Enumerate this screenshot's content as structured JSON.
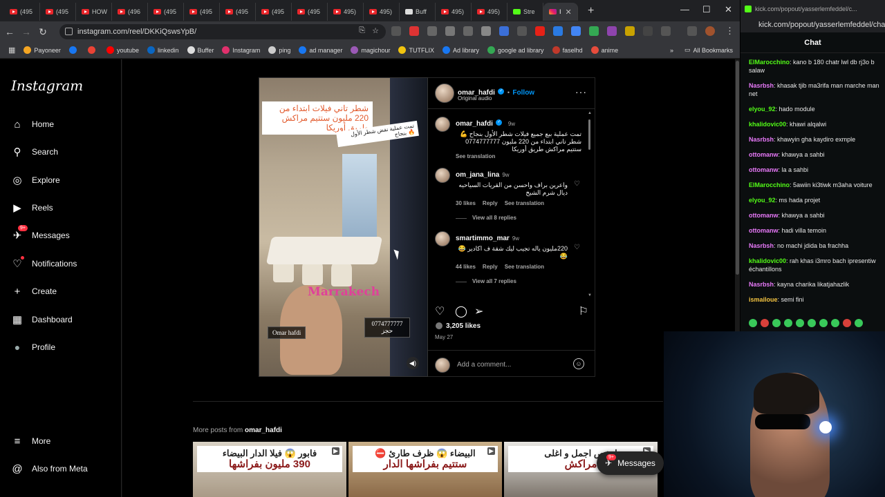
{
  "browser": {
    "tabs": [
      {
        "label": "(495",
        "icon": "youtube-icon"
      },
      {
        "label": "(495",
        "icon": "youtube-icon"
      },
      {
        "label": "HOW",
        "icon": "youtube-icon"
      },
      {
        "label": "(496",
        "icon": "youtube-icon"
      },
      {
        "label": "(495",
        "icon": "youtube-icon"
      },
      {
        "label": "(495",
        "icon": "youtube-icon"
      },
      {
        "label": "(495",
        "icon": "youtube-icon"
      },
      {
        "label": "(495",
        "icon": "youtube-icon"
      },
      {
        "label": "(495",
        "icon": "youtube-icon"
      },
      {
        "label": "495)",
        "icon": "youtube-icon"
      },
      {
        "label": "495)",
        "icon": "youtube-icon"
      },
      {
        "label": "Buff",
        "icon": "buffer-icon"
      },
      {
        "label": "495)",
        "icon": "youtube-icon"
      },
      {
        "label": "495)",
        "icon": "youtube-icon"
      },
      {
        "label": "Stre",
        "icon": "kick-icon"
      },
      {
        "label": "I",
        "icon": "instagram-icon"
      }
    ],
    "url": "instagram.com/reel/DKKiQswsYpB/",
    "bookmarks": [
      {
        "label": "Payoneer",
        "color": "#f5a623"
      },
      {
        "label": "",
        "color": "#1877f2"
      },
      {
        "label": "",
        "color": "#ea4335"
      },
      {
        "label": "youtube",
        "color": "#ff0000"
      },
      {
        "label": "linkedin",
        "color": "#0a66c2"
      },
      {
        "label": "Buffer",
        "color": "#dddddd"
      },
      {
        "label": "Instagram",
        "color": "#e1306c"
      },
      {
        "label": "ping",
        "color": "#cccccc"
      },
      {
        "label": "ad manager",
        "color": "#1877f2"
      },
      {
        "label": "magichour",
        "color": "#9b59b6"
      },
      {
        "label": "TUTFLIX",
        "color": "#f1c40f"
      },
      {
        "label": "Ad library",
        "color": "#1877f2"
      },
      {
        "label": "google ad library",
        "color": "#34a853"
      },
      {
        "label": "faselhd",
        "color": "#c0392b"
      },
      {
        "label": "anime",
        "color": "#e74c3c"
      }
    ],
    "all_bookmarks": "All Bookmarks"
  },
  "instagram": {
    "logo": "Instagram",
    "nav": [
      {
        "label": "Home",
        "icon": "home-icon",
        "glyph": "⌂"
      },
      {
        "label": "Search",
        "icon": "search-icon",
        "glyph": "⚲"
      },
      {
        "label": "Explore",
        "icon": "compass-icon",
        "glyph": "◎"
      },
      {
        "label": "Reels",
        "icon": "reels-icon",
        "glyph": "▶"
      },
      {
        "label": "Messages",
        "icon": "messenger-icon",
        "glyph": "✈"
      },
      {
        "label": "Notifications",
        "icon": "heart-icon",
        "glyph": "♡"
      },
      {
        "label": "Create",
        "icon": "plus-icon",
        "glyph": "+"
      },
      {
        "label": "Dashboard",
        "icon": "dashboard-icon",
        "glyph": "▦"
      },
      {
        "label": "Profile",
        "icon": "avatar-icon",
        "glyph": "●"
      }
    ],
    "messages_badge": "9+",
    "more": "More",
    "also_from_meta": "Also from Meta",
    "reel": {
      "overlay_title": "شطر تاني فيلات ابتداء من 220 مليون ستتيم مراكش طريق أوريكا",
      "overlay_sub": "تمت عملية نفض شطر الأول بنجاح 🔥",
      "watermark": "Marrakech",
      "name_tag": "Omar hafdi",
      "phone_tag": "0774777777",
      "phone_sub": "حجز"
    },
    "post": {
      "username": "omar_hafdi",
      "follow": "Follow",
      "audio": "Original audio",
      "caption_user": "omar_hafdi",
      "caption_time": "9w",
      "caption": "تمت عملية بيع جميع فيلات شطر الأول بنجاح 💪 شطر تاني ابتداء من 220 مليون 0774777777 ستتيم مراكش طريق أوريكا",
      "see_translation": "See translation",
      "comments": [
        {
          "user": "om_jana_lina",
          "time": "9w",
          "text": "واعرين براف واحسن من القريات السياحيه ديال شرم الشيخ",
          "likes": "30 likes",
          "reply": "Reply",
          "translate": "See translation",
          "replies": "View all 8 replies"
        },
        {
          "user": "smartimmo_mar",
          "time": "9w",
          "text": "220مليون ياله تجيب ليك شقة ف اكادير 😂😂",
          "likes": "44 likes",
          "reply": "Reply",
          "translate": "See translation",
          "replies": "View all 7 replies"
        }
      ],
      "likes": "3,205 likes",
      "date": "May 27",
      "add_comment": "Add a comment..."
    },
    "more_posts_label": "More posts from",
    "more_posts_user": "omar_hafdi",
    "thumbs": [
      {
        "caption": "فابور 😱 فيلا الدار البيضاء",
        "price": "390 مليون بفراشها"
      },
      {
        "caption": "البيضاء 😱 ظرف طارئ ⛔",
        "price": "ستتيم بفراشها الدار"
      },
      {
        "caption": "ارخص اجمل و اغلى",
        "price": "مراكش"
      }
    ],
    "messages_pill": "Messages",
    "messages_pill_badge": "9+"
  },
  "kick": {
    "title": "kick.com/popout/yasserlemfeddel/c...",
    "url": "kick.com/popout/yasserlemfeddel/chat",
    "chat_header": "Chat",
    "messages": [
      {
        "user": "ElMarocchino",
        "color": "#53fc18",
        "text": "kano b 180 chatr lwl db rj3o b salaw"
      },
      {
        "user": "Nasrbsh",
        "color": "#e879f9",
        "text": "khasak tjib ma3rifa man marche man net"
      },
      {
        "user": "elyou_92",
        "color": "#53fc18",
        "text": "hado module"
      },
      {
        "user": "khalidovic00",
        "color": "#53fc18",
        "text": "khawi alqalwi"
      },
      {
        "user": "Nasrbsh",
        "color": "#e879f9",
        "text": "khawyin gha kaydiro exmple"
      },
      {
        "user": "ottomanw",
        "color": "#e879f9",
        "text": "khawya a sahbi"
      },
      {
        "user": "ottomanw",
        "color": "#e879f9",
        "text": "la a sahbi"
      },
      {
        "user": "ElMarocchino",
        "color": "#53fc18",
        "text": "5awiin ki3tiwk m3aha voiture"
      },
      {
        "user": "elyou_92",
        "color": "#53fc18",
        "text": "ms hada projet"
      },
      {
        "user": "ottomanw",
        "color": "#e879f9",
        "text": "khawya a sahbi"
      },
      {
        "user": "ottomanw",
        "color": "#e879f9",
        "text": "hadi villa temoin"
      },
      {
        "user": "Nasrbsh",
        "color": "#e879f9",
        "text": "no machi jdida ba frachha"
      },
      {
        "user": "khalidovic00",
        "color": "#53fc18",
        "text": "rah khas i3mro bach ipresentiw échantillons"
      },
      {
        "user": "Nasrbsh",
        "color": "#e879f9",
        "text": "kayna charika likatjahazlik"
      },
      {
        "user": "ismailoue",
        "color": "#f5c542",
        "text": "semi fini"
      }
    ]
  }
}
